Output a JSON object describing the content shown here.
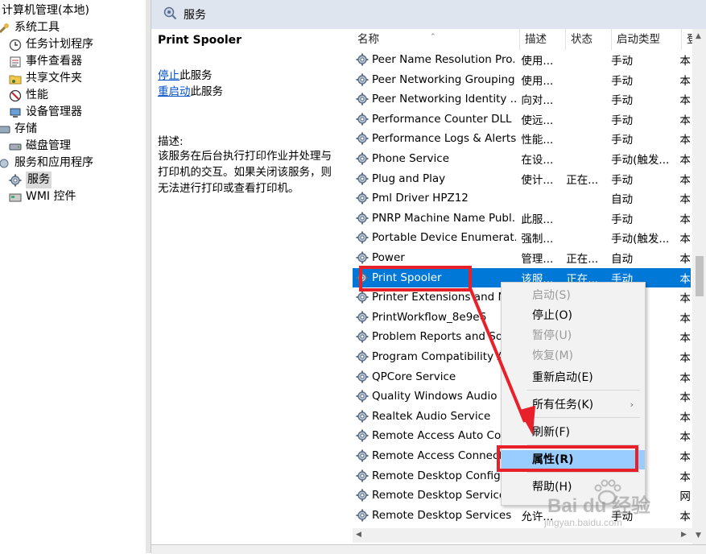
{
  "tree": {
    "items": [
      {
        "label": "计算机管理(本地)",
        "icon": "computer-management-icon"
      },
      {
        "label": "系统工具",
        "icon": "tools-icon"
      },
      {
        "label": "任务计划程序",
        "icon": "clock-icon"
      },
      {
        "label": "事件查看器",
        "icon": "event-viewer-icon"
      },
      {
        "label": "共享文件夹",
        "icon": "shared-folder-icon"
      },
      {
        "label": "性能",
        "icon": "performance-icon"
      },
      {
        "label": "设备管理器",
        "icon": "device-manager-icon"
      },
      {
        "label": "存储",
        "icon": "storage-icon"
      },
      {
        "label": "磁盘管理",
        "icon": "disk-icon"
      },
      {
        "label": "服务和应用程序",
        "icon": "services-apps-icon"
      },
      {
        "label": "服务",
        "icon": "gear-icon"
      },
      {
        "label": "WMI 控件",
        "icon": "wmi-icon"
      }
    ]
  },
  "panel": {
    "title": "服务",
    "icon": "search-gear-icon"
  },
  "details": {
    "service_name": "Print Spooler",
    "stop_link": "停止",
    "stop_suffix": "此服务",
    "restart_link": "重启动",
    "restart_suffix": "此服务",
    "desc_label": "描述:",
    "desc_text": "该服务在后台执行打印作业并处理与打印机的交互。如果关闭该服务，则无法进行打印或查看打印机。"
  },
  "columns": {
    "name": "名称",
    "desc": "描述",
    "status": "状态",
    "startup": "启动类型",
    "logon": "登"
  },
  "services": [
    {
      "name": "Peer Name Resolution Pro...",
      "desc": "使用...",
      "status": "",
      "startup": "手动",
      "logon": "本"
    },
    {
      "name": "Peer Networking Grouping",
      "desc": "使用...",
      "status": "",
      "startup": "手动",
      "logon": "本"
    },
    {
      "name": "Peer Networking Identity ...",
      "desc": "向对...",
      "status": "",
      "startup": "手动",
      "logon": "本"
    },
    {
      "name": "Performance Counter DLL ...",
      "desc": "使远...",
      "status": "",
      "startup": "手动",
      "logon": "本"
    },
    {
      "name": "Performance Logs & Alerts",
      "desc": "性能...",
      "status": "",
      "startup": "手动",
      "logon": "本"
    },
    {
      "name": "Phone Service",
      "desc": "在设...",
      "status": "",
      "startup": "手动(触发...",
      "logon": "本"
    },
    {
      "name": "Plug and Play",
      "desc": "使计...",
      "status": "正在...",
      "startup": "手动",
      "logon": "本"
    },
    {
      "name": "Pml Driver HPZ12",
      "desc": "",
      "status": "",
      "startup": "自动",
      "logon": "本"
    },
    {
      "name": "PNRP Machine Name Publ...",
      "desc": "此服...",
      "status": "",
      "startup": "手动",
      "logon": "本"
    },
    {
      "name": "Portable Device Enumerat...",
      "desc": "强制...",
      "status": "",
      "startup": "手动(触发...",
      "logon": "本"
    },
    {
      "name": "Power",
      "desc": "管理...",
      "status": "正在...",
      "startup": "自动",
      "logon": "本"
    },
    {
      "name": "Print Spooler",
      "desc": "该服...",
      "status": "正在...",
      "startup": "手动",
      "logon": "本"
    },
    {
      "name": "Printer Extensions and No",
      "desc": "",
      "status": "",
      "startup": "",
      "logon": "本"
    },
    {
      "name": "PrintWorkflow_8e9e6",
      "desc": "",
      "status": "",
      "startup": "",
      "logon": "本"
    },
    {
      "name": "Problem Reports and Sol",
      "desc": "",
      "status": "",
      "startup": "",
      "logon": "本"
    },
    {
      "name": "Program Compatibility As",
      "desc": "",
      "status": "",
      "startup": "",
      "logon": "本"
    },
    {
      "name": "QPCore Service",
      "desc": "",
      "status": "",
      "startup": "",
      "logon": "本"
    },
    {
      "name": "Quality Windows Audio V",
      "desc": "",
      "status": "",
      "startup": "",
      "logon": "本"
    },
    {
      "name": "Realtek Audio Service",
      "desc": "",
      "status": "",
      "startup": "",
      "logon": "本"
    },
    {
      "name": "Remote Access Auto Con",
      "desc": "",
      "status": "",
      "startup": "",
      "logon": "本"
    },
    {
      "name": "Remote Access Connect",
      "desc": "",
      "status": "",
      "startup": "",
      "logon": "本"
    },
    {
      "name": "Remote Desktop Configu",
      "desc": "",
      "status": "",
      "startup": "",
      "logon": "本"
    },
    {
      "name": "Remote Desktop Service",
      "desc": "",
      "status": "",
      "startup": "",
      "logon": "网"
    },
    {
      "name": "Remote Desktop Services ...",
      "desc": "允许...",
      "status": "",
      "startup": "手动",
      "logon": "本"
    }
  ],
  "selected_index": 11,
  "context_menu": {
    "items": [
      {
        "label": "启动(S)",
        "enabled": false
      },
      {
        "label": "停止(O)",
        "enabled": true
      },
      {
        "label": "暂停(U)",
        "enabled": false
      },
      {
        "label": "恢复(M)",
        "enabled": false
      },
      {
        "label": "重新启动(E)",
        "enabled": true
      },
      {
        "label": "所有任务(K)",
        "enabled": true,
        "submenu": "›"
      },
      {
        "label": "刷新(F)",
        "enabled": true
      },
      {
        "label": "属性(R)",
        "enabled": true,
        "bold": true,
        "highlighted": true
      },
      {
        "label": "帮助(H)",
        "enabled": true
      }
    ]
  },
  "watermark": {
    "brand": "Bai du 经验",
    "url": "jingyan.baidu.com"
  },
  "colors": {
    "selection": "#0078d7",
    "menu_highlight": "#99ccff",
    "annotation_red": "#e8202a",
    "header_bg": "#dfe5ef"
  }
}
